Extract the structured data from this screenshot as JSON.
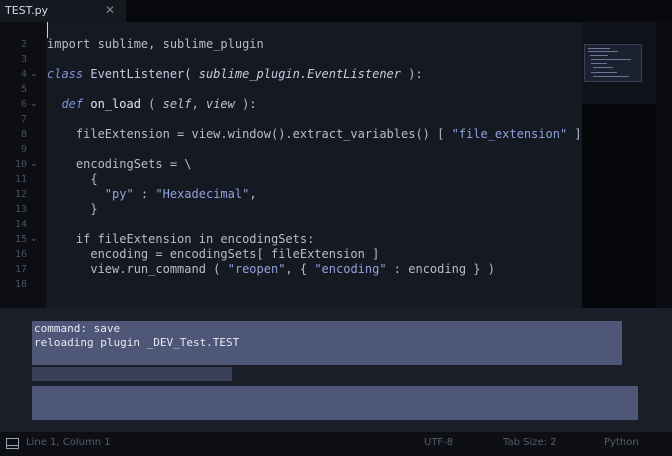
{
  "tab": {
    "label": "TEST.py",
    "close": "✕"
  },
  "editor": {
    "lines": [
      {
        "num": "",
        "fold": ""
      },
      {
        "num": "2",
        "fold": ""
      },
      {
        "num": "3",
        "fold": ""
      },
      {
        "num": "4",
        "fold": "⌄"
      },
      {
        "num": "5",
        "fold": ""
      },
      {
        "num": "6",
        "fold": "⌄"
      },
      {
        "num": "7",
        "fold": ""
      },
      {
        "num": "8",
        "fold": ""
      },
      {
        "num": "9",
        "fold": ""
      },
      {
        "num": "10",
        "fold": "⌄"
      },
      {
        "num": "11",
        "fold": ""
      },
      {
        "num": "12",
        "fold": ""
      },
      {
        "num": "13",
        "fold": ""
      },
      {
        "num": "14",
        "fold": ""
      },
      {
        "num": "15",
        "fold": "⌄"
      },
      {
        "num": "16",
        "fold": ""
      },
      {
        "num": "17",
        "fold": ""
      },
      {
        "num": "18",
        "fold": ""
      }
    ],
    "code": {
      "l2": {
        "kw": "import",
        "rest": " sublime, sublime_plugin"
      },
      "l4": {
        "kw": "class",
        "name": " EventListener( ",
        "base": "sublime_plugin.EventListener",
        "end": " ):"
      },
      "l6": {
        "indent": "  ",
        "kw": "def",
        "fn": " on_load",
        "open": " ( ",
        "p1": "self",
        "comma": ", ",
        "p2": "view",
        "end": " ):"
      },
      "l8": {
        "pre": "    fileExtension = view.window().extract_variables() [ ",
        "str": "\"file_extension\"",
        "post": " ]"
      },
      "l10": {
        "text": "    encodingSets = \\"
      },
      "l11": {
        "text": "      {"
      },
      "l12": {
        "indent": "        ",
        "key": "\"py\"",
        "mid": " : ",
        "val": "\"Hexadecimal\"",
        "end": ","
      },
      "l13": {
        "text": "      }"
      },
      "l15": {
        "text": "    if fileExtension in encodingSets:"
      },
      "l16": {
        "text": "      encoding = encodingSets[ fileExtension ]"
      },
      "l17": {
        "pre": "      view.run_command ( ",
        "s1": "\"reopen\"",
        "mid": ", { ",
        "s2": "\"encoding\"",
        "post": " : encoding } )"
      }
    }
  },
  "console": {
    "lines": [
      "command: save",
      "reloading plugin _DEV_Test.TEST"
    ]
  },
  "status": {
    "position": "Line 1, Column 1",
    "encoding": "UTF-8",
    "tab_size": "Tab Size: 2",
    "syntax": "Python"
  },
  "colors": {
    "background": "#0b0d13",
    "code_bg": "#151922",
    "panel_bg": "#1a1e29",
    "console_bg": "#4e5778",
    "keyword": "#7f93d4",
    "string": "#8fa2da"
  },
  "icons": {
    "panel_toggle": "panel-toggle-icon",
    "fold": "fold-chevron-icon",
    "close": "close-icon"
  }
}
